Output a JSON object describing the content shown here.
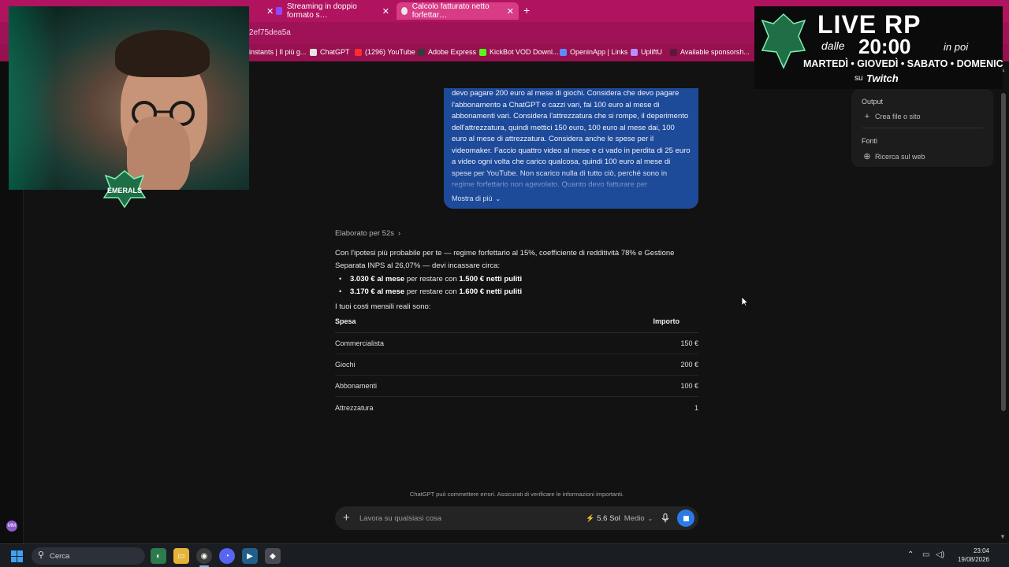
{
  "browser": {
    "tabs": [
      {
        "label": "Streaming in doppio formato s…",
        "active": false
      },
      {
        "label": "Calcolo fatturato netto forfettar…",
        "active": true
      }
    ],
    "url_fragment": "2ef75dea5a",
    "bookmarks": [
      "instants | Il più g...",
      "ChatGPT",
      "(1296) YouTube",
      "Adobe Express",
      "KickBot VOD Downl...",
      "OpeninApp | Links",
      "UpliftU",
      "Available sponsorsh..."
    ]
  },
  "user_message": {
    "text": "devo pagare 200 euro al mese di giochi. Considera che devo pagare l'abbonamento a ChatGPT e cazzi vari, fai 100 euro al mese di abbonamenti vari. Considera l'attrezzatura che si rompe, il deperimento dell'attrezzatura, quindi mettici 150 euro, 100 euro al mese dai, 100 euro al mese di attrezzatura. Considera anche le spese per il videomaker. Faccio quattro video al mese e ci vado in perdita di 25 euro a video ogni volta che carico qualcosa, quindi 100 euro al mese di spese per YouTube. Non scarico nulla di tutto ciò, perché sono in regime forfettario non agevolato. Quanto devo fatturare per",
    "show_more": "Mostra di più"
  },
  "assistant": {
    "reasoned": "Elaborato per 52s",
    "intro": "Con l'ipotesi più probabile per te — regime forfettario al 15%, coefficiente di redditività 78% e Gestione Separata INPS al 26,07% — devi incassare circa:",
    "bullets": [
      {
        "amount": "3.030 € al mese",
        "middle": " per restare con ",
        "net": "1.500 € netti puliti"
      },
      {
        "amount": "3.170 € al mese",
        "middle": " per restare con ",
        "net": "1.600 € netti puliti"
      }
    ],
    "costs_intro": "I tuoi costi mensili reali sono:",
    "table": {
      "headers": [
        "Spesa",
        "Importo"
      ],
      "rows": [
        [
          "Commercialista",
          "150 €"
        ],
        [
          "Giochi",
          "200 €"
        ],
        [
          "Abbonamenti",
          "100 €"
        ],
        [
          "Attrezzatura",
          "1"
        ]
      ]
    }
  },
  "right_panel": {
    "output_heading": "Output",
    "create_item": "Crea file o sito",
    "sources_heading": "Fonti",
    "web_item": "Ricerca sul web"
  },
  "composer": {
    "disclaimer": "ChatGPT può commettere errori. Assicurati di verificare le informazioni importanti.",
    "placeholder": "Lavora su qualsiasi cosa",
    "model": "5.6 Sol",
    "effort": "Medio"
  },
  "taskbar": {
    "search": "Cerca",
    "time": "23:04",
    "date": "19/08/2026"
  },
  "sidebar": {
    "avatar_initials": "MM"
  },
  "stream_overlay": {
    "badge_text": "EMERALS",
    "live": "LIVE RP",
    "dalle": "dalle",
    "time": "20:00",
    "in_poi": "in poi",
    "days": "MARTEDÌ • GIOVEDÌ • SABATO • DOMENICA",
    "su": "su",
    "platform": "Twitch"
  },
  "colors": {
    "tab_bar": "#b0135f",
    "user_bubble": "#1e4a9a",
    "send_stop": "#2a7be8",
    "page_bg": "#121212"
  }
}
